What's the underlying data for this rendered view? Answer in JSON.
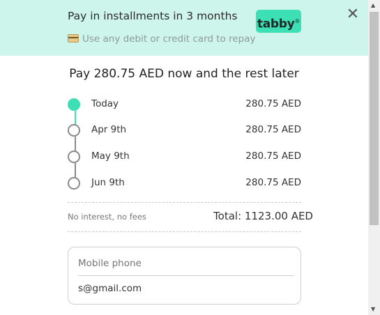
{
  "header": {
    "title": "Pay in installments in 3 months",
    "subtitle": "Use any debit or credit card to repay",
    "logo_text": "tabby",
    "logo_mark": "®",
    "close_symbol": "✕"
  },
  "main": {
    "title": "Pay 280.75 AED now and the rest later"
  },
  "schedule": [
    {
      "date": "Today",
      "amount": "280.75 AED",
      "active": true
    },
    {
      "date": "Apr 9th",
      "amount": "280.75 AED",
      "active": false
    },
    {
      "date": "May 9th",
      "amount": "280.75 AED",
      "active": false
    },
    {
      "date": "Jun 9th",
      "amount": "280.75 AED",
      "active": false
    }
  ],
  "summary": {
    "note": "No interest, no fees",
    "total": "Total: 1123.00 AED"
  },
  "form": {
    "phone_placeholder": "Mobile phone",
    "email_value": "s@gmail.com"
  },
  "colors": {
    "brand": "#3de0b4",
    "header_bg": "#cdf5eb"
  },
  "icons": {
    "card": "credit-card-icon",
    "close": "close-icon"
  }
}
